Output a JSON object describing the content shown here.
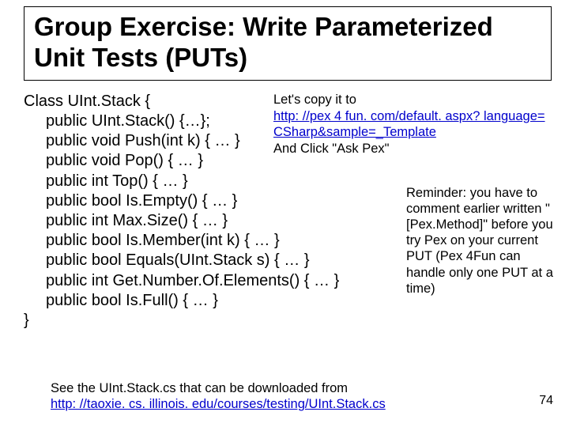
{
  "title": "Group Exercise: Write Parameterized Unit Tests (PUTs)",
  "code": {
    "l0": "Class UInt.Stack {",
    "l1": "public UInt.Stack() {…};",
    "l2": "public void Push(int k) { … }",
    "l3": "public void Pop() { … }",
    "l4": "public int Top() { … }",
    "l5": "public bool Is.Empty() { … }",
    "l6": "public int Max.Size() { … }",
    "l7": "public bool Is.Member(int k) { … }",
    "l8": "public bool Equals(UInt.Stack s) { … }",
    "l9": "public int Get.Number.Of.Elements() { … }",
    "l10": "public bool Is.Full() { … }",
    "l11": "}"
  },
  "instr": {
    "line1": "Let's copy it to",
    "link1": "http: //pex 4 fun. com/default. aspx? language=",
    "link2": "CSharp&sample=_Template",
    "line2": "And Click \"Ask Pex\""
  },
  "reminder": "Reminder: you have to comment earlier written \"[Pex.Method]\" before you try Pex on your current PUT (Pex 4Fun can handle only one PUT at a time)",
  "footer": {
    "line1": "See the UInt.Stack.cs that can be downloaded from",
    "link": "http: //taoxie. cs. illinois. edu/courses/testing/UInt.Stack.cs"
  },
  "page": "74"
}
